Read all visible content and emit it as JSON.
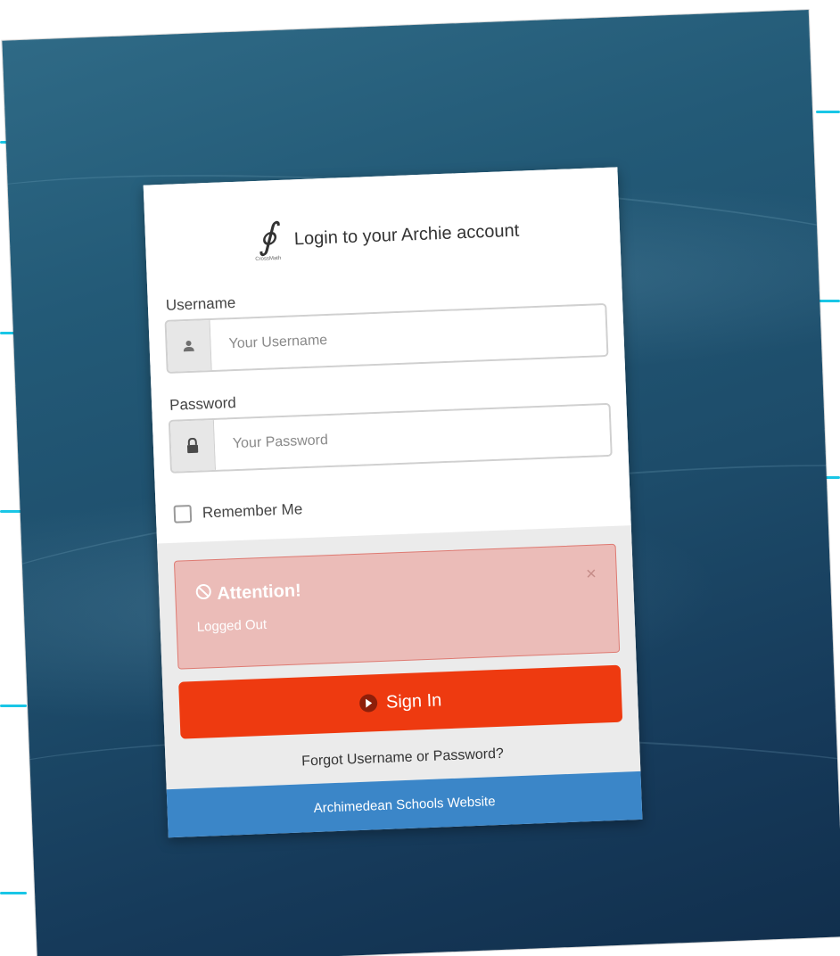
{
  "header": {
    "title": "Login to your Archie account",
    "logo_caption": "CrossMath"
  },
  "form": {
    "username_label": "Username",
    "username_placeholder": "Your Username",
    "username_value": "",
    "password_label": "Password",
    "password_placeholder": "Your Password",
    "password_value": "",
    "remember_label": "Remember Me",
    "remember_checked": false
  },
  "alert": {
    "title": "Attention!",
    "message": "Logged Out",
    "close_glyph": "×"
  },
  "actions": {
    "signin_label": "Sign In",
    "forgot_label": "Forgot Username or Password?"
  },
  "footer": {
    "link_label": "Archimedean Schools Website"
  },
  "colors": {
    "signin_button": "#ee3a10",
    "footer_bar": "#3b86c8",
    "alert_bg": "#ebbcb8",
    "background": "#1d4c6a"
  },
  "icons": {
    "username": "user-icon",
    "password": "lock-icon",
    "alert": "ban-icon",
    "signin": "play-circle-icon"
  }
}
